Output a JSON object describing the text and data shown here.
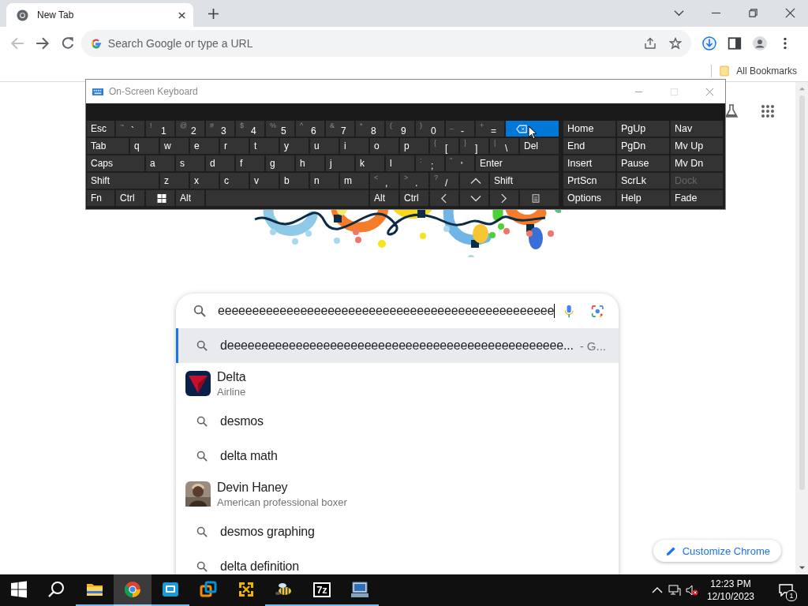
{
  "browser": {
    "tab": {
      "title": "New Tab"
    },
    "omnibox": {
      "placeholder": "Search Google or type a URL"
    },
    "bookmarks": [
      {
        "label": "All Bookmarks"
      }
    ]
  },
  "new_tab_page": {
    "search": {
      "value": "eeeeeeeeeeeeeeeeeeeeeeeeeeeeeeeeeeeeeeeeeeeeeeeee"
    },
    "suggestions": [
      {
        "kind": "search",
        "text": "deeeeeeeeeeeeeeeeeeeeeeeeeeeeeeeeeeeeeeeeeeeeeeeee...",
        "suffix": "- G...",
        "selected": true
      },
      {
        "kind": "logo",
        "text": "Delta",
        "subtitle": "Airline",
        "selected": false
      },
      {
        "kind": "search",
        "text": "desmos",
        "selected": false
      },
      {
        "kind": "search",
        "text": "delta math",
        "selected": false
      },
      {
        "kind": "picture",
        "text": "Devin Haney",
        "subtitle": "American professional boxer",
        "selected": false
      },
      {
        "kind": "search",
        "text": "desmos graphing",
        "selected": false
      },
      {
        "kind": "search",
        "text": "delta definition",
        "selected": false
      }
    ],
    "customize_button": "Customize Chrome"
  },
  "osk": {
    "title": "On-Screen Keyboard",
    "rows": [
      [
        {
          "kind": "text",
          "label": "Esc",
          "hover": false
        },
        {
          "kind": "text",
          "shift": "~",
          "label": "`",
          "hover": false
        },
        {
          "kind": "text",
          "shift": "!",
          "label": "1",
          "hover": false
        },
        {
          "kind": "text",
          "shift": "@",
          "label": "2",
          "hover": false
        },
        {
          "kind": "text",
          "shift": "#",
          "label": "3",
          "hover": false
        },
        {
          "kind": "text",
          "shift": "$",
          "label": "4",
          "hover": false
        },
        {
          "kind": "text",
          "shift": "%",
          "label": "5",
          "hover": false
        },
        {
          "kind": "text",
          "shift": "^",
          "label": "6",
          "hover": false
        },
        {
          "kind": "text",
          "shift": "&",
          "label": "7",
          "hover": false
        },
        {
          "kind": "text",
          "shift": "*",
          "label": "8",
          "hover": false
        },
        {
          "kind": "text",
          "shift": "(",
          "label": "9",
          "hover": false
        },
        {
          "kind": "text",
          "shift": ")",
          "label": "0",
          "hover": false
        },
        {
          "kind": "text",
          "shift": "_",
          "label": "-",
          "hover": false
        },
        {
          "kind": "text",
          "shift": "+",
          "label": "=",
          "hover": false
        },
        {
          "kind": "backspace",
          "hover": true
        }
      ],
      [
        {
          "kind": "text",
          "label": "Tab",
          "hover": false
        },
        {
          "kind": "text",
          "label": "q",
          "hover": false
        },
        {
          "kind": "text",
          "label": "w",
          "hover": false
        },
        {
          "kind": "text",
          "label": "e",
          "hover": false
        },
        {
          "kind": "text",
          "label": "r",
          "hover": false
        },
        {
          "kind": "text",
          "label": "t",
          "hover": false
        },
        {
          "kind": "text",
          "label": "y",
          "hover": false
        },
        {
          "kind": "text",
          "label": "u",
          "hover": false
        },
        {
          "kind": "text",
          "label": "i",
          "hover": false
        },
        {
          "kind": "text",
          "label": "o",
          "hover": false
        },
        {
          "kind": "text",
          "label": "p",
          "hover": false
        },
        {
          "kind": "text",
          "shift": "{",
          "label": "[",
          "hover": false
        },
        {
          "kind": "text",
          "shift": "}",
          "label": "]",
          "hover": false
        },
        {
          "kind": "text",
          "shift": "|",
          "label": "\\",
          "hover": false
        },
        {
          "kind": "text",
          "label": "Del",
          "hover": false
        }
      ],
      [
        {
          "kind": "text",
          "label": "Caps",
          "hover": false
        },
        {
          "kind": "text",
          "label": "a",
          "hover": false
        },
        {
          "kind": "text",
          "label": "s",
          "hover": false
        },
        {
          "kind": "text",
          "label": "d",
          "hover": false
        },
        {
          "kind": "text",
          "label": "f",
          "hover": false
        },
        {
          "kind": "text",
          "label": "g",
          "hover": false
        },
        {
          "kind": "text",
          "label": "h",
          "hover": false
        },
        {
          "kind": "text",
          "label": "j",
          "hover": false
        },
        {
          "kind": "text",
          "label": "k",
          "hover": false
        },
        {
          "kind": "text",
          "label": "l",
          "hover": false
        },
        {
          "kind": "text",
          "shift": ":",
          "label": ";",
          "hover": false
        },
        {
          "kind": "text",
          "shift": "\"",
          "label": "'",
          "hover": false
        },
        {
          "kind": "text",
          "label": "Enter",
          "hover": false
        }
      ],
      [
        {
          "kind": "text",
          "label": "Shift",
          "hover": false
        },
        {
          "kind": "text",
          "label": "z",
          "hover": false
        },
        {
          "kind": "text",
          "label": "x",
          "hover": false
        },
        {
          "kind": "text",
          "label": "c",
          "hover": false
        },
        {
          "kind": "text",
          "label": "v",
          "hover": false
        },
        {
          "kind": "text",
          "label": "b",
          "hover": false
        },
        {
          "kind": "text",
          "label": "n",
          "hover": false
        },
        {
          "kind": "text",
          "label": "m",
          "hover": false
        },
        {
          "kind": "text",
          "shift": "<",
          "label": ",",
          "hover": false
        },
        {
          "kind": "text",
          "shift": ">",
          "label": ".",
          "hover": false
        },
        {
          "kind": "text",
          "shift": "?",
          "label": "/",
          "hover": false
        },
        {
          "kind": "up",
          "hover": false
        },
        {
          "kind": "text",
          "label": "Shift",
          "hover": false
        }
      ],
      [
        {
          "kind": "text",
          "label": "Fn",
          "hover": false
        },
        {
          "kind": "text",
          "label": "Ctrl",
          "hover": false
        },
        {
          "kind": "windows",
          "hover": false
        },
        {
          "kind": "text",
          "label": "Alt",
          "hover": false
        },
        {
          "kind": "space",
          "hover": false
        },
        {
          "kind": "text",
          "label": "Alt",
          "hover": false
        },
        {
          "kind": "text",
          "label": "Ctrl",
          "hover": false
        },
        {
          "kind": "left",
          "hover": false
        },
        {
          "kind": "down",
          "hover": false
        },
        {
          "kind": "right",
          "hover": false
        },
        {
          "kind": "menu",
          "hover": false
        }
      ]
    ],
    "nav_rows": [
      [
        {
          "label": "Home",
          "disabled": false
        },
        {
          "label": "PgUp",
          "disabled": false
        },
        {
          "label": "Nav",
          "disabled": false
        }
      ],
      [
        {
          "label": "End",
          "disabled": false
        },
        {
          "label": "PgDn",
          "disabled": false
        },
        {
          "label": "Mv Up",
          "disabled": false
        }
      ],
      [
        {
          "label": "Insert",
          "disabled": false
        },
        {
          "label": "Pause",
          "disabled": false
        },
        {
          "label": "Mv Dn",
          "disabled": false
        }
      ],
      [
        {
          "label": "PrtScn",
          "disabled": false
        },
        {
          "label": "ScrLk",
          "disabled": false
        },
        {
          "label": "Dock",
          "disabled": true
        }
      ],
      [
        {
          "label": "Options",
          "disabled": false
        },
        {
          "label": "Help",
          "disabled": false
        },
        {
          "label": "Fade",
          "disabled": false
        }
      ]
    ]
  },
  "taskbar": {
    "apps": [
      {
        "kind": "start",
        "running": false,
        "active": false
      },
      {
        "kind": "search",
        "running": false,
        "active": false
      },
      {
        "kind": "folder",
        "running": true,
        "active": false
      },
      {
        "kind": "browser",
        "running": true,
        "active": true
      },
      {
        "kind": "mail",
        "running": true,
        "active": false
      },
      {
        "kind": "squares",
        "running": false,
        "active": false
      },
      {
        "kind": "arrows",
        "running": false,
        "active": false
      },
      {
        "kind": "bee",
        "running": true,
        "active": false
      },
      {
        "kind": "archive",
        "label": "7z",
        "running": true,
        "active": false
      },
      {
        "kind": "network",
        "running": true,
        "active": false
      }
    ],
    "clock": {
      "time": "12:23 PM",
      "date": "12/10/2023"
    },
    "notifications": "1"
  }
}
